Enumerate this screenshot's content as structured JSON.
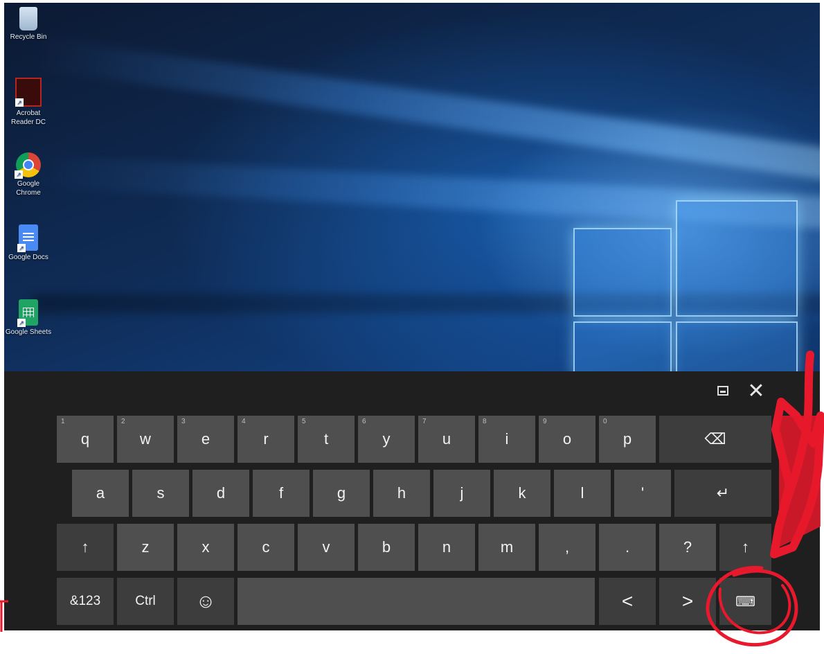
{
  "desktop": {
    "icons": [
      {
        "label": "Recycle Bin",
        "icon": "recycle-bin-icon"
      },
      {
        "label": "Acrobat Reader DC",
        "icon": "acrobat-icon"
      },
      {
        "label": "Google Chrome",
        "icon": "chrome-icon"
      },
      {
        "label": "Google Docs",
        "icon": "google-docs-icon"
      },
      {
        "label": "Google Sheets",
        "icon": "google-sheets-icon"
      }
    ]
  },
  "keyboard": {
    "row1": [
      {
        "label": "q",
        "hint": "1"
      },
      {
        "label": "w",
        "hint": "2"
      },
      {
        "label": "e",
        "hint": "3"
      },
      {
        "label": "r",
        "hint": "4"
      },
      {
        "label": "t",
        "hint": "5"
      },
      {
        "label": "y",
        "hint": "6"
      },
      {
        "label": "u",
        "hint": "7"
      },
      {
        "label": "i",
        "hint": "8"
      },
      {
        "label": "o",
        "hint": "9"
      },
      {
        "label": "p",
        "hint": "0"
      },
      {
        "label": "⌫",
        "hint": ""
      }
    ],
    "row2": [
      "a",
      "s",
      "d",
      "f",
      "g",
      "h",
      "j",
      "k",
      "l",
      "'",
      "↵"
    ],
    "row3": [
      "↑",
      "z",
      "x",
      "c",
      "v",
      "b",
      "n",
      "m",
      ",",
      ".",
      "?",
      "↑"
    ],
    "row4": [
      "&123",
      "Ctrl",
      "☺",
      "",
      "<",
      ">",
      "⌨"
    ],
    "top": {
      "dock": "▭",
      "close": "✕"
    }
  },
  "colors": {
    "annotation": "#e8192c",
    "key": "#4f4f4f",
    "keyboard_bg": "#1f1f1f"
  }
}
